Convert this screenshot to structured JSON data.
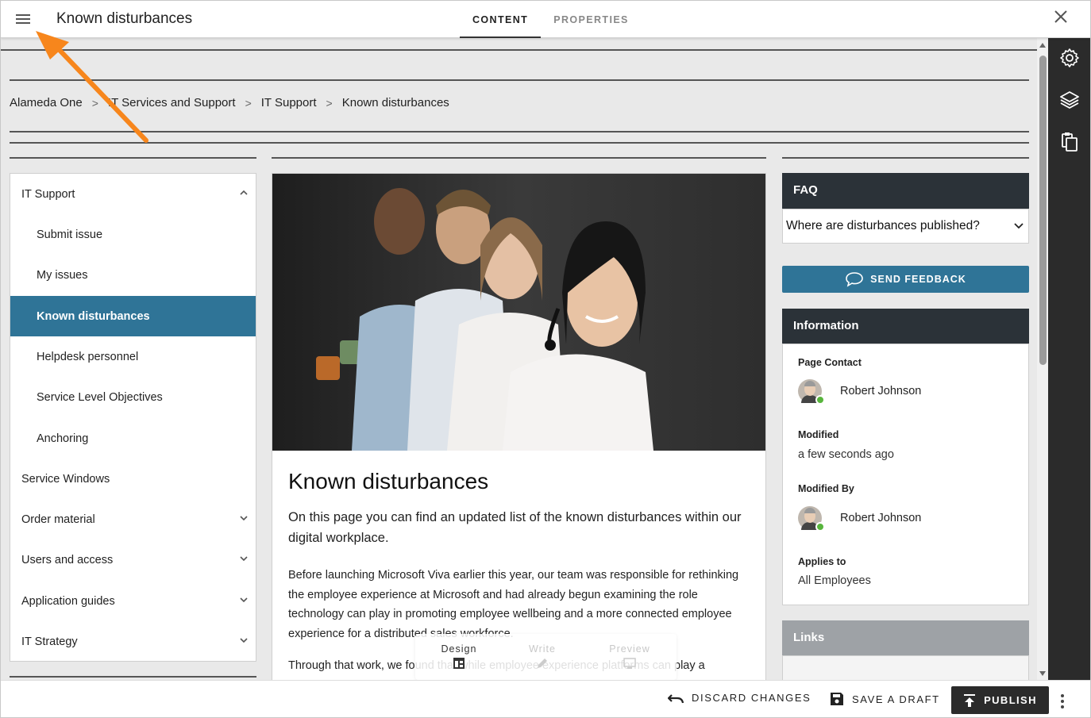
{
  "header": {
    "title": "Known disturbances",
    "tabs": [
      {
        "label": "CONTENT",
        "active": true
      },
      {
        "label": "PROPERTIES",
        "active": false
      }
    ]
  },
  "breadcrumb": [
    "Alameda One",
    "IT Services and Support",
    "IT Support",
    "Known disturbances"
  ],
  "breadcrumb_separator": ">",
  "left_nav": {
    "items": [
      {
        "label": "IT Support",
        "level": "top",
        "expanded": true
      },
      {
        "label": "Submit issue",
        "level": "sub"
      },
      {
        "label": "My issues",
        "level": "sub"
      },
      {
        "label": "Known disturbances",
        "level": "sub",
        "active": true
      },
      {
        "label": "Helpdesk personnel",
        "level": "sub"
      },
      {
        "label": "Service Level Objectives",
        "level": "sub"
      },
      {
        "label": "Anchoring",
        "level": "sub"
      },
      {
        "label": "Service Windows",
        "level": "top"
      },
      {
        "label": "Order material",
        "level": "top",
        "expandable": true
      },
      {
        "label": "Users and access",
        "level": "top",
        "expandable": true
      },
      {
        "label": "Application guides",
        "level": "top",
        "expandable": true
      },
      {
        "label": "IT Strategy",
        "level": "top",
        "expandable": true
      }
    ]
  },
  "article": {
    "title": "Known disturbances",
    "lead": "On this page you can find an updated list of the known disturbances within our digital workplace.",
    "p1": "Before launching Microsoft Viva earlier this year, our team was responsible for rethinking the employee experience at Microsoft and had already begun examining the role technology can play in promoting employee wellbeing and a more connected employee experience for a distributed sales workforce.",
    "p2": "Through that work, we found that while employee experience platforms can play a"
  },
  "modes": {
    "design": "Design",
    "write": "Write",
    "preview": "Preview"
  },
  "faq": {
    "heading": "FAQ",
    "question": "Where are disturbances published?"
  },
  "feedback_label": "SEND FEEDBACK",
  "information": {
    "heading": "Information",
    "page_contact_label": "Page Contact",
    "page_contact_name": "Robert Johnson",
    "modified_label": "Modified",
    "modified_value": "a few seconds ago",
    "modified_by_label": "Modified By",
    "modified_by_name": "Robert Johnson",
    "applies_to_label": "Applies to",
    "applies_to_value": "All Employees"
  },
  "links": {
    "heading": "Links"
  },
  "bottom": {
    "discard": "DISCARD CHANGES",
    "save_draft": "SAVE A DRAFT",
    "publish": "PUBLISH"
  },
  "colors": {
    "accent": "#2f7497",
    "dark_header": "#2b3238",
    "toolbar": "#2b2b2b",
    "annotation_arrow": "#f7861c",
    "presence": "#58b53d"
  },
  "icons": {
    "menu": "hamburger-icon",
    "close": "close-icon",
    "settings": "gear-icon",
    "layers": "layers-icon",
    "clipboard": "clipboard-icon",
    "feedback": "chat-bubble-icon",
    "discard": "undo-icon",
    "save": "floppy-icon",
    "publish": "upload-icon",
    "more": "kebab-icon"
  }
}
